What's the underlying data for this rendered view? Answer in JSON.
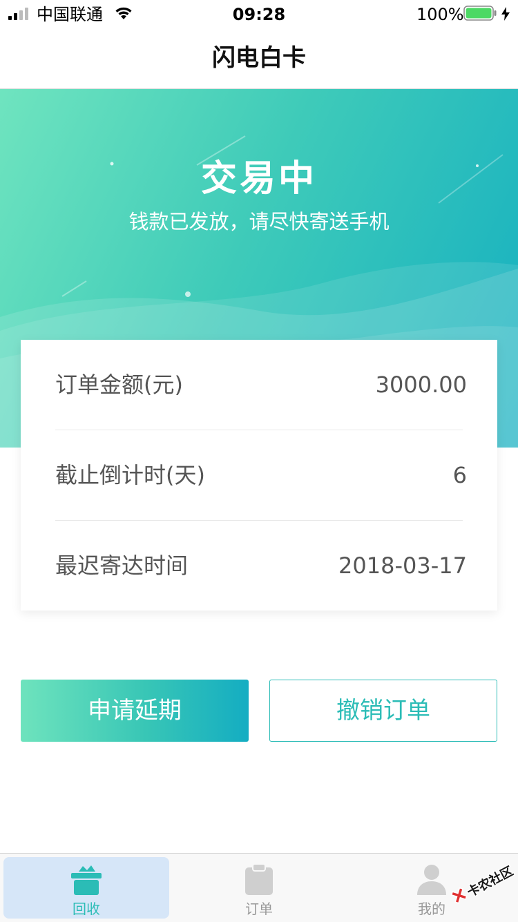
{
  "status_bar": {
    "carrier": "中国联通",
    "time": "09:28",
    "battery": "100%"
  },
  "nav": {
    "title": "闪电白卡"
  },
  "hero": {
    "status": "交易中",
    "subtitle": "钱款已发放，请尽快寄送手机"
  },
  "details": [
    {
      "label": "订单金额(元)",
      "value": "3000.00"
    },
    {
      "label": "截止倒计时(天)",
      "value": "6"
    },
    {
      "label": "最迟寄达时间",
      "value": "2018-03-17"
    }
  ],
  "actions": {
    "extend_label": "申请延期",
    "cancel_label": "撤销订单"
  },
  "tabs": [
    {
      "label": "回收",
      "icon": "recycle-box-icon",
      "active": true
    },
    {
      "label": "订单",
      "icon": "clipboard-icon",
      "active": false
    },
    {
      "label": "我的",
      "icon": "user-icon",
      "active": false
    }
  ],
  "watermark": {
    "text": "卡农社区"
  },
  "colors": {
    "accent": "#2bbcb6",
    "gradient_start": "#6ee3bd",
    "gradient_end": "#14adc2",
    "tab_active_bg": "#d6e6f8"
  }
}
